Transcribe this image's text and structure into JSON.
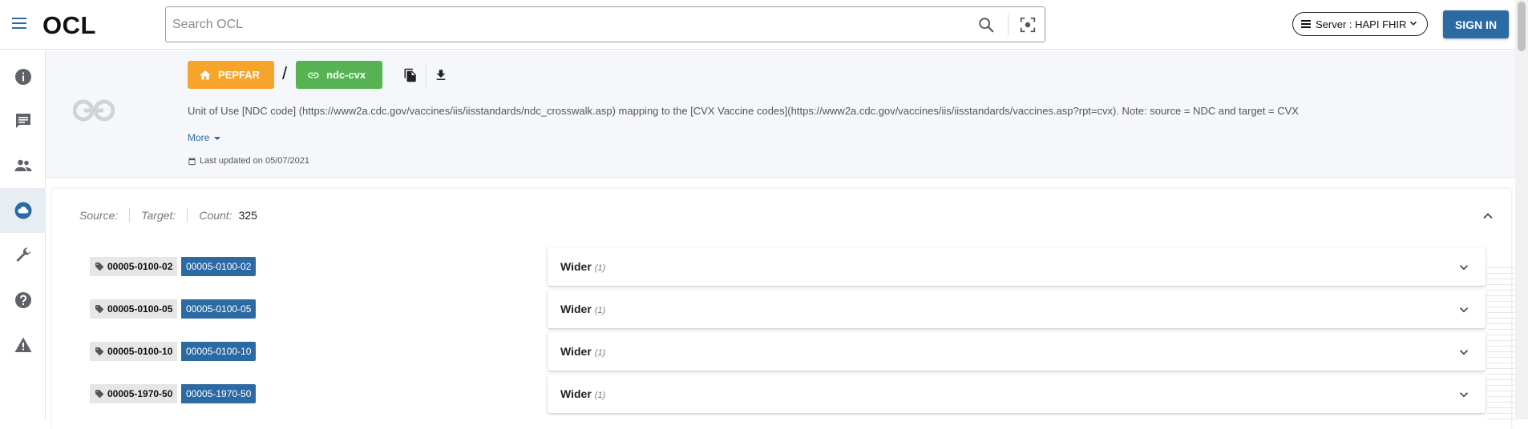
{
  "app": {
    "logo": "OCL"
  },
  "search": {
    "placeholder": "Search OCL"
  },
  "server": {
    "label": "Server : HAPI FHIR"
  },
  "auth": {
    "signin_label": "SIGN IN"
  },
  "sidebar": {
    "items": [
      {
        "icon": "info-icon"
      },
      {
        "icon": "chat-icon"
      },
      {
        "icon": "people-icon"
      },
      {
        "icon": "cloud-icon",
        "active": true
      },
      {
        "icon": "wrench-icon"
      },
      {
        "icon": "help-icon"
      },
      {
        "icon": "warning-icon"
      }
    ]
  },
  "header": {
    "org_label": "PEPFAR",
    "separator": "/",
    "source_label": "ndc-cvx",
    "description": "Unit of Use [NDC code] (https://www2a.cdc.gov/vaccines/iis/iisstandards/ndc_crosswalk.asp) mapping to the [CVX Vaccine codes](https://www2a.cdc.gov/vaccines/iis/iisstandards/vaccines.asp?rpt=cvx). Note: source = NDC and target = CVX",
    "more_label": "More",
    "updated_label": "Last updated on 05/07/2021"
  },
  "summary": {
    "source_label": "Source:",
    "target_label": "Target:",
    "count_label": "Count:",
    "count_value": "325"
  },
  "mappings": [
    {
      "from_code": "00005-0100-02",
      "to_code": "00005-0100-02",
      "relationship": "Wider",
      "count": "(1)"
    },
    {
      "from_code": "00005-0100-05",
      "to_code": "00005-0100-05",
      "relationship": "Wider",
      "count": "(1)"
    },
    {
      "from_code": "00005-0100-10",
      "to_code": "00005-0100-10",
      "relationship": "Wider",
      "count": "(1)"
    },
    {
      "from_code": "00005-1970-50",
      "to_code": "00005-1970-50",
      "relationship": "Wider",
      "count": "(1)"
    }
  ],
  "colors": {
    "primary": "#2c6aa4",
    "org_chip": "#f7a52a",
    "source_chip": "#57b352"
  }
}
